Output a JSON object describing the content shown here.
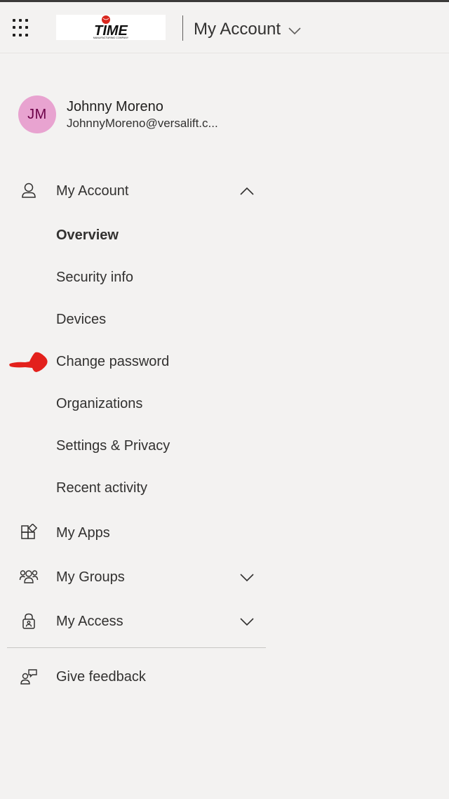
{
  "header": {
    "app_title": "My Account",
    "logo_text": "TIME",
    "logo_subtext": "MANUFACTURING COMPANY"
  },
  "profile": {
    "initials": "JM",
    "name": "Johnny Moreno",
    "email": "JohnnyMoreno@versalift.c..."
  },
  "nav": {
    "my_account": {
      "label": "My Account",
      "subitems": [
        "Overview",
        "Security info",
        "Devices",
        "Change password",
        "Organizations",
        "Settings & Privacy",
        "Recent activity"
      ]
    },
    "my_apps": {
      "label": "My Apps"
    },
    "my_groups": {
      "label": "My Groups"
    },
    "my_access": {
      "label": "My Access"
    },
    "give_feedback": {
      "label": "Give feedback"
    }
  },
  "colors": {
    "background": "#f3f2f1",
    "avatar_bg": "#e8a3d0",
    "avatar_text": "#6b0047",
    "annotation_arrow": "#e3211c"
  }
}
